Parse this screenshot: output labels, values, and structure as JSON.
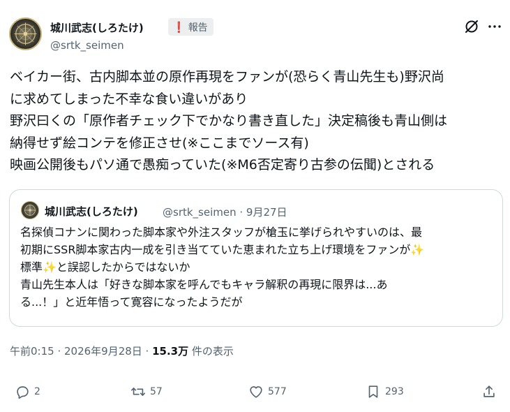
{
  "post": {
    "author_name": "城川武志(しろたけ)",
    "handle": "@srtk_seimen",
    "report_label": "報告",
    "report_icon": "exclamation-icon",
    "lines": [
      "ベイカー街、古内脚本並の原作再現をファンが(恐らく青山先生も)野沢尚",
      "に求めてしまった不幸な食い違いがあり",
      "野沢曰くの「原作者チェック下でかなり書き直した」決定稿後も青山側は",
      "納得せず絵コンテを修正させ(※ここまでソース有)",
      "映画公開後もパソ通で愚痴っていた(※M6否定寄り古参の伝聞)とされる"
    ]
  },
  "quote": {
    "author_name": "城川武志(しろたけ)",
    "meta": "@srtk_seimen · 9月27日",
    "lines": [
      "名探偵コナンに関わった脚本家や外注スタッフが槍玉に挙げられやすいのは、最",
      "初期にSSR脚本家古内一成を引き当てていた恵まれた立ち上げ環境をファンが✨",
      "標準✨と誤認したからではないか",
      "青山先生本人は「好きな脚本家を呼んでもキャラ解釈の再現に限界は...あ",
      "る...！」と近年悟って寛容になったようだが"
    ]
  },
  "meta": {
    "time": "午前0:15 · 2026年9月28日 · ",
    "views": "15.3万",
    "views_suffix": " 件の表示"
  },
  "actions": {
    "replies": "2",
    "reposts": "57",
    "likes": "577",
    "bookmarks": "293"
  },
  "colors": {
    "text": "#0f1419",
    "secondary": "#536471",
    "border": "#cfd9de",
    "report_red": "#f4212e"
  }
}
